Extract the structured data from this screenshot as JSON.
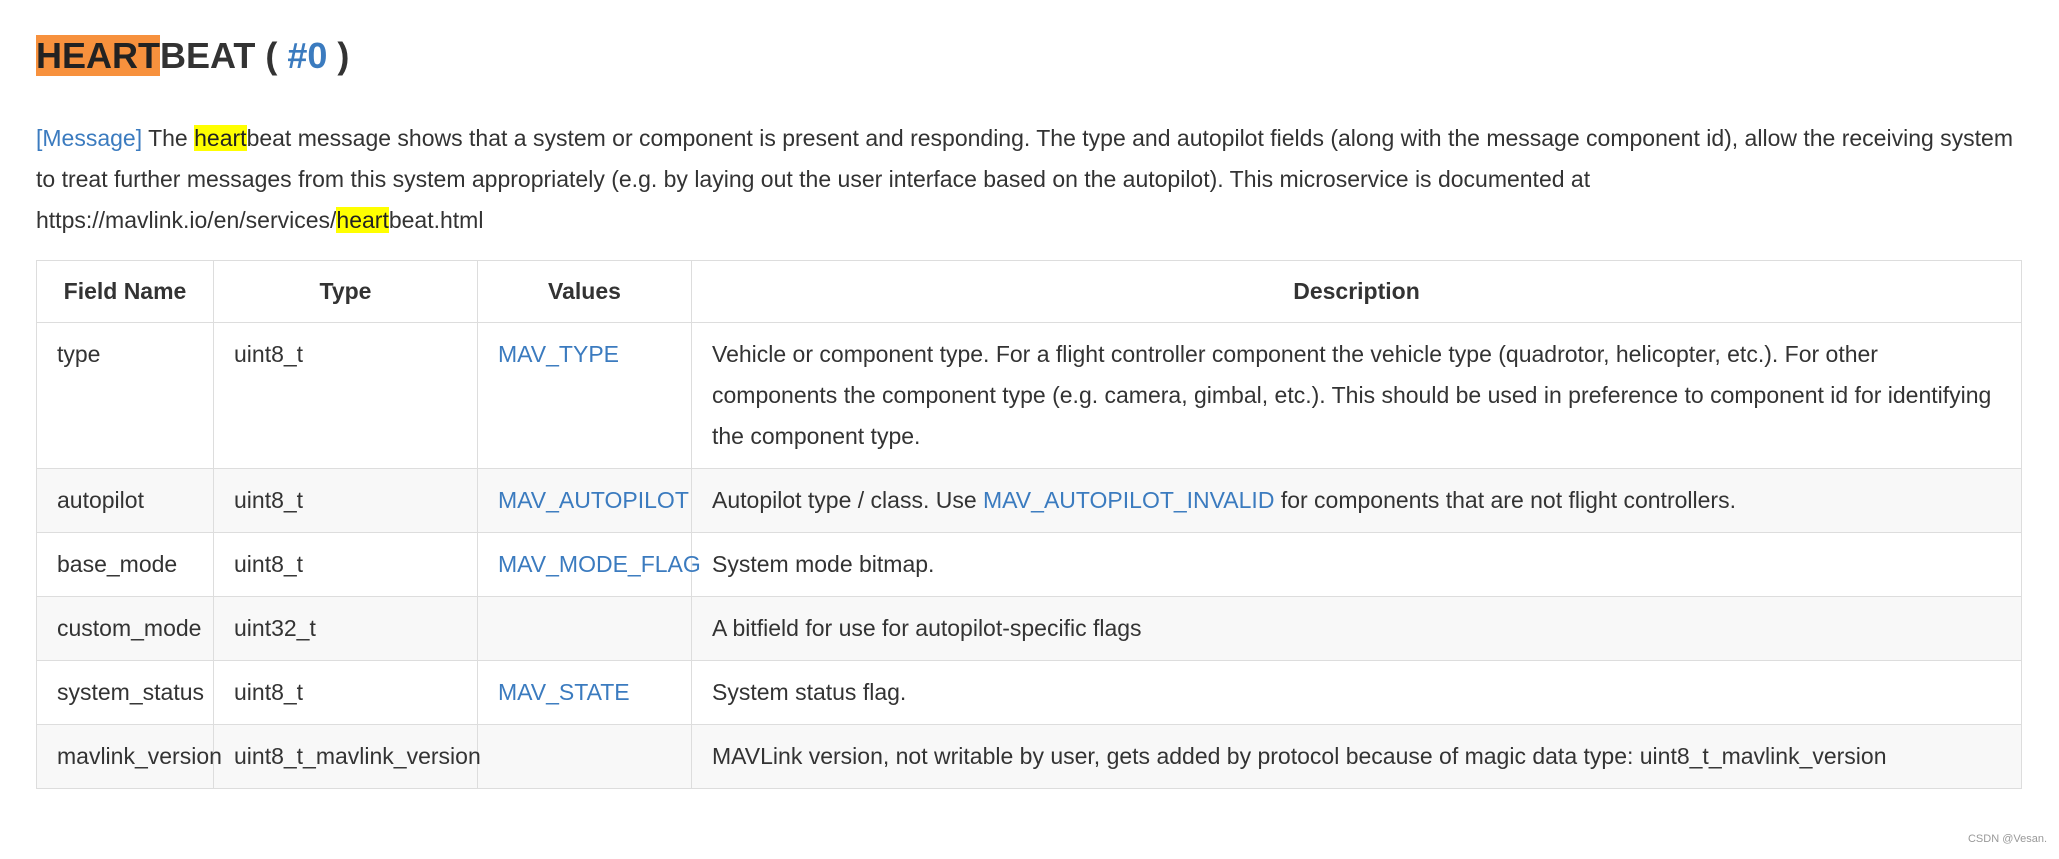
{
  "header": {
    "title_highlight": "HEART",
    "title_rest": "BEAT",
    "title_open": "(",
    "title_id": "#0",
    "title_close": ")"
  },
  "description": {
    "tag": "[Message]",
    "part1": "The",
    "hl1": "heart",
    "part2": "beat message shows that a system or component is present and responding. The type and autopilot fields (along with the message component id), allow the receiving system to treat further messages from this system appropriately (e.g. by laying out the user interface based on the autopilot). This microservice is documented at https://mavlink.io/en/services/",
    "hl2": "heart",
    "part3": "beat.html"
  },
  "table": {
    "headers": [
      "Field Name",
      "Type",
      "Values",
      "Description"
    ],
    "rows": [
      {
        "name": "type",
        "type": "uint8_t",
        "values": "MAV_TYPE",
        "desc": "Vehicle or component type. For a flight controller component the vehicle type (quadrotor, helicopter, etc.). For other components the component type (e.g. camera, gimbal, etc.). This should be used in preference to component id for identifying the component type."
      },
      {
        "name": "autopilot",
        "type": "uint8_t",
        "values": "MAV_AUTOPILOT",
        "desc_pre": "Autopilot type / class. Use",
        "desc_link": "MAV_AUTOPILOT_INVALID",
        "desc_post": "for components that are not flight controllers."
      },
      {
        "name": "base_mode",
        "type": "uint8_t",
        "values": "MAV_MODE_FLAG",
        "desc": "System mode bitmap."
      },
      {
        "name": "custom_mode",
        "type": "uint32_t",
        "values": "",
        "desc": "A bitfield for use for autopilot-specific flags"
      },
      {
        "name": "system_status",
        "type": "uint8_t",
        "values": "MAV_STATE",
        "desc": "System status flag."
      },
      {
        "name": "mavlink_version",
        "type": "uint8_t_mavlink_version",
        "values": "",
        "desc": "MAVLink version, not writable by user, gets added by protocol because of magic data type: uint8_t_mavlink_version"
      }
    ]
  },
  "watermark": "CSDN @Vesan.",
  "colors": {
    "link": "#3b7bbf",
    "highlight_orange": "#f7913d",
    "highlight_yellow": "#ffff00",
    "text": "#333333"
  }
}
